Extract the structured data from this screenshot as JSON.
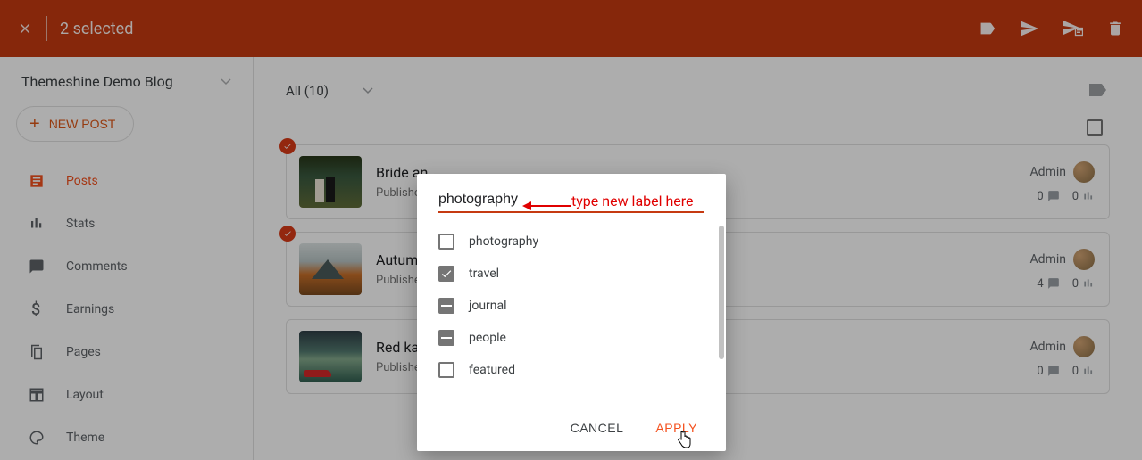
{
  "topbar": {
    "selected_text": "2 selected"
  },
  "sidebar": {
    "blog_name": "Themeshine Demo Blog",
    "new_post_label": "NEW POST",
    "items": [
      {
        "label": "Posts"
      },
      {
        "label": "Stats"
      },
      {
        "label": "Comments"
      },
      {
        "label": "Earnings"
      },
      {
        "label": "Pages"
      },
      {
        "label": "Layout"
      },
      {
        "label": "Theme"
      }
    ]
  },
  "main": {
    "filter_label": "All (10)"
  },
  "posts": [
    {
      "title": "Bride an",
      "status": "Publishe",
      "author": "Admin",
      "comments": "0",
      "views": "0",
      "selected": true
    },
    {
      "title": "Autumn",
      "status": "Publishe",
      "author": "Admin",
      "comments": "4",
      "views": "0",
      "selected": true
    },
    {
      "title": "Red kay",
      "status": "Publishe",
      "author": "Admin",
      "comments": "0",
      "views": "0",
      "selected": false
    }
  ],
  "modal": {
    "input_value": "photography",
    "labels": [
      {
        "name": "photography",
        "state": "unchecked"
      },
      {
        "name": "travel",
        "state": "checked"
      },
      {
        "name": "journal",
        "state": "indeterminate"
      },
      {
        "name": "people",
        "state": "indeterminate"
      },
      {
        "name": "featured",
        "state": "unchecked"
      }
    ],
    "cancel_label": "CANCEL",
    "apply_label": "APPLY"
  },
  "annotation": {
    "text": "type new label here"
  }
}
